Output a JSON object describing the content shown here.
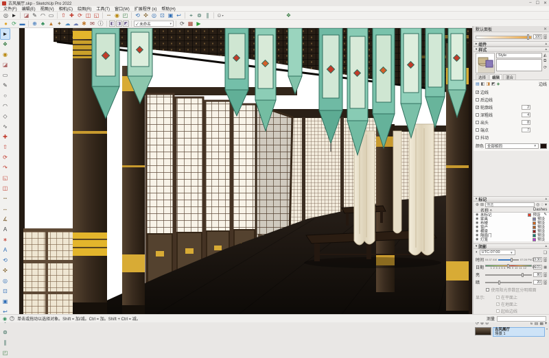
{
  "window": {
    "title": "古风展厅.skp - SketchUp Pro 2022",
    "min": "–",
    "max": "☐",
    "close": "✕"
  },
  "menu": {
    "items": [
      "文件(F)",
      "编辑(E)",
      "视图(V)",
      "相机(C)",
      "绘图(R)",
      "工具(T)",
      "窗口(W)",
      "扩展程序 (x)",
      "帮助(H)"
    ]
  },
  "toolbar_main": {
    "items": [
      {
        "name": "search-icon",
        "glyph": "◎",
        "color": "#444"
      },
      {
        "name": "select-tool-icon",
        "glyph": "►",
        "color": "#222"
      },
      {
        "name": "sep"
      },
      {
        "name": "eraser-icon",
        "glyph": "◪",
        "color": "#b06a6a"
      },
      {
        "name": "line-tool-icon",
        "glyph": "✎",
        "color": "#444"
      },
      {
        "name": "arc-tool-icon",
        "glyph": "◠",
        "color": "#444"
      },
      {
        "name": "rectangle-tool-icon",
        "glyph": "▭",
        "color": "#444"
      },
      {
        "name": "sep"
      },
      {
        "name": "push-pull-icon",
        "glyph": "⇧",
        "color": "#c0392b"
      },
      {
        "name": "move-tool-icon",
        "glyph": "✚",
        "color": "#c0392b"
      },
      {
        "name": "rotate-tool-icon",
        "glyph": "⟳",
        "color": "#c0392b"
      },
      {
        "name": "offset-tool-icon",
        "glyph": "◫",
        "color": "#c0392b"
      },
      {
        "name": "scale-tool-icon",
        "glyph": "◱",
        "color": "#c0392b"
      },
      {
        "name": "sep"
      },
      {
        "name": "tape-measure-icon",
        "glyph": "┉",
        "color": "#7a5a2a"
      },
      {
        "name": "paint-bucket-icon",
        "glyph": "◉",
        "color": "#b8860b"
      },
      {
        "name": "section-plane-icon",
        "glyph": "◰",
        "color": "#3a7d44"
      },
      {
        "name": "sep"
      },
      {
        "name": "orbit-icon",
        "glyph": "⟲",
        "color": "#2d6cb5"
      },
      {
        "name": "pan-icon",
        "glyph": "✜",
        "color": "#8a6d3b"
      },
      {
        "name": "zoom-icon",
        "glyph": "◎",
        "color": "#2d6cb5"
      },
      {
        "name": "zoom-window-icon",
        "glyph": "⊡",
        "color": "#2d6cb5"
      },
      {
        "name": "zoom-extents-icon",
        "glyph": "▣",
        "color": "#2d6cb5"
      },
      {
        "name": "previous-view-icon",
        "glyph": "↩",
        "color": "#2d6cb5"
      },
      {
        "name": "sep"
      },
      {
        "name": "position-camera-icon",
        "glyph": "⌖",
        "color": "#356a5a"
      },
      {
        "name": "look-around-icon",
        "glyph": "⊚",
        "color": "#356a5a"
      },
      {
        "name": "walk-icon",
        "glyph": "∥",
        "color": "#356a5a"
      },
      {
        "name": "sep"
      },
      {
        "name": "user-account-icon",
        "glyph": "☺",
        "color": "#555",
        "caret": true
      }
    ],
    "trailing_icon": {
      "name": "component-options-icon",
      "glyph": "❖",
      "color": "#3a7d44"
    }
  },
  "toolbar_plugins": {
    "items": [
      {
        "name": "plugin-yellow-icon",
        "glyph": "●",
        "color": "#e0a62e"
      },
      {
        "name": "plugin-refresh-icon",
        "glyph": "⟳",
        "color": "#3a9d5a"
      },
      {
        "name": "plugin-layers-icon",
        "glyph": "▬",
        "color": "#2d6cb5"
      },
      {
        "name": "sep"
      },
      {
        "name": "add-location-icon",
        "glyph": "⊕",
        "color": "#2d6cb5"
      },
      {
        "name": "tree-component-icon",
        "glyph": "♣",
        "color": "#2e8b57"
      },
      {
        "name": "photo-match-icon",
        "glyph": "▲",
        "color": "#c07a2e"
      },
      {
        "name": "pattern-icon",
        "glyph": "✦",
        "color": "#8a6d3b"
      },
      {
        "name": "cloud-icon",
        "glyph": "☁",
        "color": "#4a8ac2"
      },
      {
        "name": "cloud-sync-icon",
        "glyph": "☁",
        "color": "#6a7ab2"
      },
      {
        "name": "settings-icon",
        "glyph": "✱",
        "color": "#c07a2e"
      },
      {
        "name": "mail-icon",
        "glyph": "✉",
        "color": "#8b3a3a"
      },
      {
        "name": "info-icon",
        "glyph": "ⓘ",
        "color": "#444"
      },
      {
        "name": "sep"
      }
    ],
    "view_boxes": [
      {
        "name": "box-view-iso-icon",
        "glyph": "◧"
      },
      {
        "name": "box-view-top-icon",
        "glyph": "◨"
      },
      {
        "name": "box-view-front-icon",
        "glyph": "◩"
      }
    ],
    "view_dropdown": "未命名",
    "right_items": [
      {
        "name": "scene-update-icon",
        "glyph": "⟳",
        "color": "#555"
      },
      {
        "name": "render-window-icon",
        "glyph": "▦",
        "color": "#a03a2a"
      },
      {
        "name": "play-animation-icon",
        "glyph": "▶",
        "color": "#2e9d3a"
      }
    ]
  },
  "palette": {
    "tools": [
      {
        "name": "select-tool",
        "glyph": "►",
        "color": "#222",
        "active": true
      },
      {
        "name": "make-component-tool",
        "glyph": "❖",
        "color": "#3a7d44"
      },
      {
        "name": "paint-bucket-tool",
        "glyph": "◉",
        "color": "#b8860b"
      },
      {
        "name": "eraser-tool",
        "glyph": "◪",
        "color": "#b06a6a"
      },
      {
        "name": "rectangle-tool",
        "glyph": "▭",
        "color": "#444"
      },
      {
        "name": "line-tool",
        "glyph": "✎",
        "color": "#444"
      },
      {
        "name": "circle-tool",
        "glyph": "○",
        "color": "#444"
      },
      {
        "name": "arc-tool",
        "glyph": "◠",
        "color": "#444"
      },
      {
        "name": "polygon-tool",
        "glyph": "◇",
        "color": "#444"
      },
      {
        "name": "freehand-tool",
        "glyph": "∿",
        "color": "#444"
      },
      {
        "name": "move-tool",
        "glyph": "✚",
        "color": "#c0392b"
      },
      {
        "name": "push-pull-tool",
        "glyph": "⇧",
        "color": "#c0392b"
      },
      {
        "name": "rotate-tool",
        "glyph": "⟳",
        "color": "#c0392b"
      },
      {
        "name": "follow-me-tool",
        "glyph": "↷",
        "color": "#c0392b"
      },
      {
        "name": "scale-tool",
        "glyph": "◱",
        "color": "#c0392b"
      },
      {
        "name": "offset-tool",
        "glyph": "◫",
        "color": "#c0392b"
      },
      {
        "name": "tape-measure-tool",
        "glyph": "┉",
        "color": "#7a5a2a"
      },
      {
        "name": "dimension-tool",
        "glyph": "↔",
        "color": "#7a5a2a"
      },
      {
        "name": "protractor-tool",
        "glyph": "∡",
        "color": "#7a5a2a"
      },
      {
        "name": "text-tool",
        "glyph": "A",
        "color": "#444"
      },
      {
        "name": "axes-tool",
        "glyph": "∗",
        "color": "#c0392b"
      },
      {
        "name": "3d-text-tool",
        "glyph": "A",
        "color": "#2d6cb5"
      },
      {
        "name": "orbit-tool",
        "glyph": "⟲",
        "color": "#2d6cb5"
      },
      {
        "name": "pan-tool",
        "glyph": "✜",
        "color": "#8a6d3b"
      },
      {
        "name": "zoom-tool",
        "glyph": "◎",
        "color": "#2d6cb5"
      },
      {
        "name": "zoom-window-tool",
        "glyph": "⊡",
        "color": "#2d6cb5"
      },
      {
        "name": "zoom-extents-tool",
        "glyph": "▣",
        "color": "#2d6cb5"
      },
      {
        "name": "previous-view-tool",
        "glyph": "↩",
        "color": "#2d6cb5"
      },
      {
        "name": "position-camera-tool",
        "glyph": "⌖",
        "color": "#356a5a"
      },
      {
        "name": "look-around-tool",
        "glyph": "⊚",
        "color": "#356a5a"
      },
      {
        "name": "walk-tool",
        "glyph": "∥",
        "color": "#356a5a"
      },
      {
        "name": "section-plane-tool",
        "glyph": "◰",
        "color": "#3a7d44"
      }
    ]
  },
  "tray": {
    "title": "默认面板",
    "close": "✕",
    "materials": {
      "opacity_value": "100"
    },
    "components_header": "组件",
    "styles": {
      "header": "样式",
      "name_value": "Style",
      "tabs": [
        "选择",
        "编辑",
        "混合"
      ],
      "active_tab": "编辑",
      "section_label": "边线",
      "options": [
        {
          "label": "边线",
          "checked": true,
          "value": ""
        },
        {
          "label": "后边线",
          "checked": false,
          "value": ""
        },
        {
          "label": "轮廓线",
          "checked": true,
          "value": "2"
        },
        {
          "label": "深粗线",
          "checked": false,
          "value": "4"
        },
        {
          "label": "出头",
          "checked": false,
          "value": "8"
        },
        {
          "label": "端点",
          "checked": false,
          "value": "7"
        },
        {
          "label": "抖动",
          "checked": false,
          "value": ""
        }
      ],
      "color_label": "颜色",
      "color_mode": "全部相同",
      "color_swatch": "#1c0f0c"
    },
    "tags": {
      "header": "标记",
      "filter_placeholder": "筛选",
      "col_name": "名称",
      "col_dashes": "Dashes",
      "rows": [
        {
          "name": "未标记",
          "color": "#e8412c",
          "dash": "预设"
        },
        {
          "name": "家具",
          "color": "#8080a8",
          "dash": "预设"
        },
        {
          "name": "布幔",
          "color": "#d2691e",
          "dash": "预设"
        },
        {
          "name": "窗户",
          "color": "#b05a1e",
          "dash": "预设"
        },
        {
          "name": "横梁",
          "color": "#9b1c1c",
          "dash": "预设"
        },
        {
          "name": "隔扇门",
          "color": "#0e8070",
          "dash": "预设"
        },
        {
          "name": "灯笼",
          "color": "#b535d6",
          "dash": "预设"
        }
      ]
    },
    "shadows": {
      "header": "阴影",
      "timezone": "UTC-07:00",
      "time_label": "时间",
      "time_start": "04:37 AM",
      "time_end": "07:28 PM",
      "time_value": "13:30",
      "date_label": "日期",
      "date_scale": "1 2 3 4 5 6 7 8 9 10 11 12",
      "date_value": "06/21",
      "light_label": "亮",
      "light_value": "80",
      "dark_label": "暗",
      "dark_value": "20",
      "use_sun": "使用阳光参数区分明暗面",
      "display_label": "显示:",
      "display_options": [
        "在平面上",
        "在地面上",
        "起始边线"
      ]
    },
    "scenes": {
      "header": "场景",
      "item_title": "古风展厅",
      "item_subtitle": "场景 1"
    }
  },
  "statusbar": {
    "tip": "单击或拖动以选择对象。Shift = 加/减。Ctrl = 加。Shift + Ctrl = 减。",
    "measure_label": "测量"
  },
  "theme": {
    "banner_teal": "#7fc3ae",
    "banner_light": "#a7d6c0",
    "gold": "#e3b52c",
    "wood_dark": "#3a2e24",
    "floor": "#14100c",
    "selection_blue": "#cde3f7",
    "ornament_red": "#c23b2a"
  }
}
